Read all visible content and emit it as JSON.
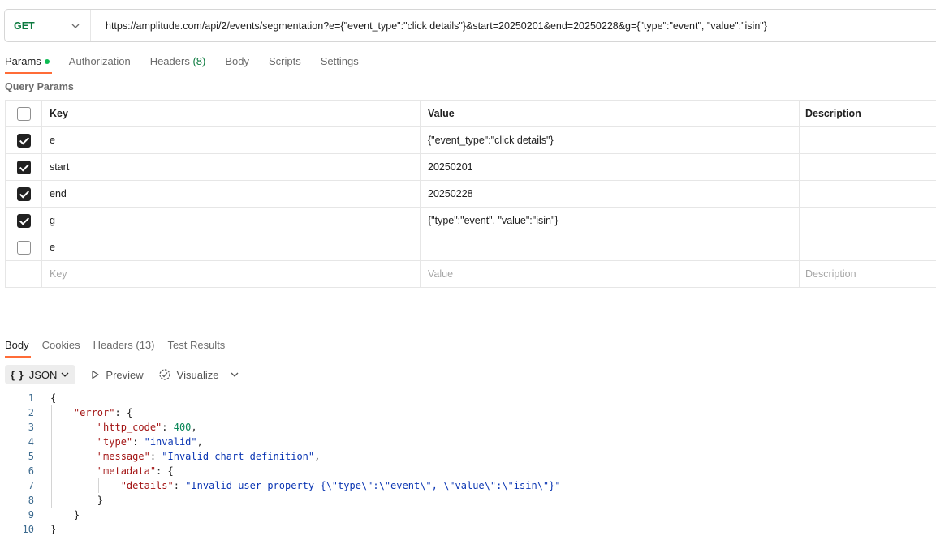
{
  "request": {
    "method": "GET",
    "url": "https://amplitude.com/api/2/events/segmentation?e={\"event_type\":\"click details\"}&start=20250201&end=20250228&g={\"type\":\"event\", \"value\":\"isin\"}"
  },
  "tabs": [
    {
      "label": "Params",
      "active": true
    },
    {
      "label": "Authorization"
    },
    {
      "label": "Headers",
      "count": "(8)"
    },
    {
      "label": "Body"
    },
    {
      "label": "Scripts"
    },
    {
      "label": "Settings"
    }
  ],
  "query_params": {
    "title": "Query Params",
    "headers": {
      "key": "Key",
      "value": "Value",
      "description": "Description"
    },
    "rows": [
      {
        "checked": true,
        "key": "e",
        "value": "{\"event_type\":\"click details\"}",
        "description": ""
      },
      {
        "checked": true,
        "key": "start",
        "value": "20250201",
        "description": ""
      },
      {
        "checked": true,
        "key": "end",
        "value": "20250228",
        "description": ""
      },
      {
        "checked": true,
        "key": "g",
        "value": "{\"type\":\"event\", \"value\":\"isin\"}",
        "description": ""
      },
      {
        "checked": false,
        "key": "e",
        "value": "",
        "description": ""
      }
    ],
    "placeholders": {
      "key": "Key",
      "value": "Value",
      "description": "Description"
    }
  },
  "response_tabs": [
    {
      "label": "Body",
      "active": true
    },
    {
      "label": "Cookies"
    },
    {
      "label": "Headers",
      "count": "(13)"
    },
    {
      "label": "Test Results"
    }
  ],
  "response_toolbar": {
    "format_braces": "{ }",
    "format": "JSON",
    "preview": "Preview",
    "visualize": "Visualize"
  },
  "response_body": {
    "line_numbers": [
      "1",
      "2",
      "3",
      "4",
      "5",
      "6",
      "7",
      "8",
      "9",
      "10"
    ],
    "open_brace": "{",
    "error_key": "\"error\"",
    "http_code_key": "\"http_code\"",
    "http_code_value": "400",
    "type_key": "\"type\"",
    "type_value": "\"invalid\"",
    "message_key": "\"message\"",
    "message_value": "\"Invalid chart definition\"",
    "metadata_key": "\"metadata\"",
    "details_key": "\"details\"",
    "details_value": "\"Invalid user property {\\\"type\\\":\\\"event\\\", \\\"value\\\":\\\"isin\\\"}\"",
    "close_brace": "}"
  },
  "colors": {
    "accent": "#ff6c37",
    "method_get": "#0c7a3f",
    "active_dot": "#0cbb52"
  }
}
